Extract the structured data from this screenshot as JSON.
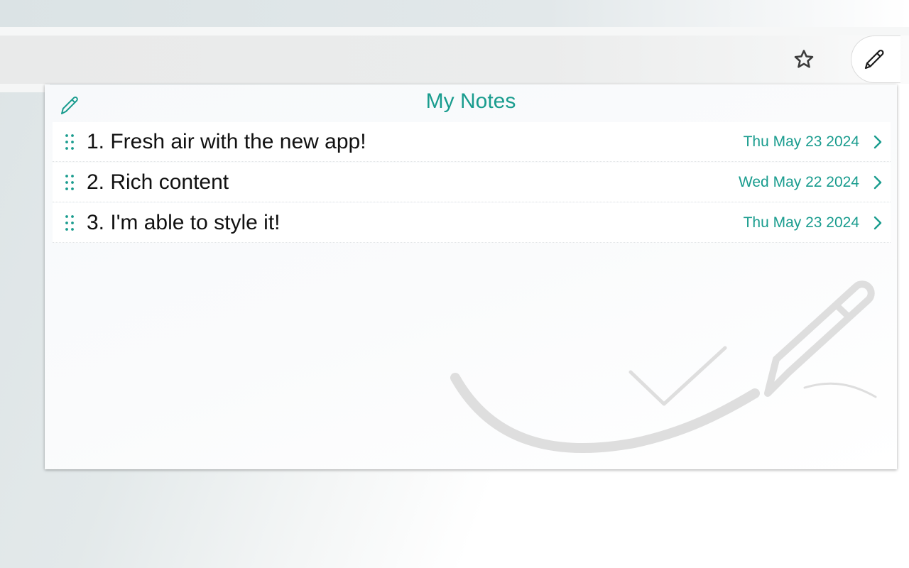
{
  "browser": {
    "star_icon": "star-outline-icon",
    "extension_icon": "pencil-icon"
  },
  "popup": {
    "title": "My Notes",
    "edit_icon": "pencil-icon",
    "notes": [
      {
        "title": "1. Fresh air with the new app!",
        "date": "Thu May 23 2024"
      },
      {
        "title": "2. Rich content",
        "date": "Wed May 22 2024"
      },
      {
        "title": "3. I'm able to style it!",
        "date": "Thu May 23 2024"
      }
    ]
  },
  "colors": {
    "accent": "#199c8e",
    "watermark": "#dedede"
  }
}
